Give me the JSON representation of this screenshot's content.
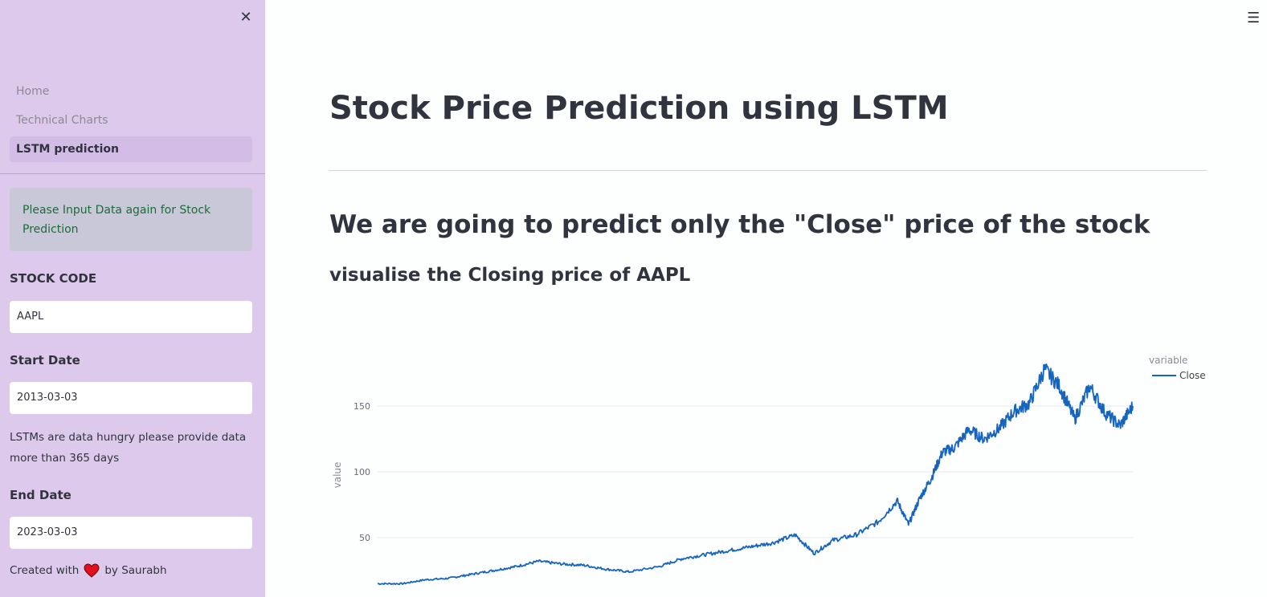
{
  "sidebar": {
    "close_icon": "close-icon",
    "nav": [
      {
        "label": "Home",
        "active": false
      },
      {
        "label": "Technical Charts",
        "active": false
      },
      {
        "label": "LSTM prediction",
        "active": true
      }
    ],
    "info_message": "Please Input Data again for Stock Prediction",
    "stock_code_label": "STOCK CODE",
    "stock_code_value": "AAPL",
    "start_date_label": "Start Date",
    "start_date_value": "2013-03-03",
    "help_text": "LSTMs are data hungry please provide data more than 365 days",
    "end_date_label": "End Date",
    "end_date_value": "2023-03-03",
    "footer_prefix": "Created with",
    "footer_suffix": "by Saurabh",
    "footer_icon": "heart-icon",
    "colors": {
      "background": "#ddc9ec",
      "info_text": "#1d6b3a",
      "heart": "#e0101e"
    }
  },
  "main": {
    "menu_icon": "hamburger-icon",
    "title": "Stock Price Prediction using LSTM",
    "subtitle": "We are going to predict only the \"Close\" price of the stock",
    "section_title": "visualise the Closing price of AAPL"
  },
  "chart_data": {
    "type": "line",
    "ylabel": "value",
    "legend_title": "variable",
    "y_ticks": [
      50,
      100,
      150
    ],
    "ylim": [
      14,
      185
    ],
    "grid": true,
    "legend_position": "top-right",
    "series": [
      {
        "name": "Close",
        "color": "#1565c0",
        "x": [
          2013.17,
          2013.5,
          2013.8,
          2014.1,
          2014.4,
          2014.7,
          2015.0,
          2015.3,
          2015.6,
          2015.9,
          2016.2,
          2016.5,
          2016.9,
          2017.2,
          2017.5,
          2017.8,
          2018.1,
          2018.4,
          2018.7,
          2018.95,
          2019.2,
          2019.5,
          2019.8,
          2020.05,
          2020.2,
          2020.35,
          2020.5,
          2020.65,
          2020.8,
          2021.0,
          2021.2,
          2021.4,
          2021.6,
          2021.8,
          2022.0,
          2022.2,
          2022.4,
          2022.6,
          2022.8,
          2023.0,
          2023.17
        ],
        "values": [
          15,
          15,
          18,
          19,
          22,
          25,
          28,
          32,
          30,
          29,
          26,
          24,
          28,
          34,
          37,
          40,
          43,
          46,
          52,
          38,
          48,
          52,
          62,
          78,
          60,
          80,
          95,
          115,
          118,
          132,
          125,
          133,
          146,
          152,
          178,
          165,
          140,
          165,
          145,
          135,
          150
        ]
      }
    ]
  }
}
